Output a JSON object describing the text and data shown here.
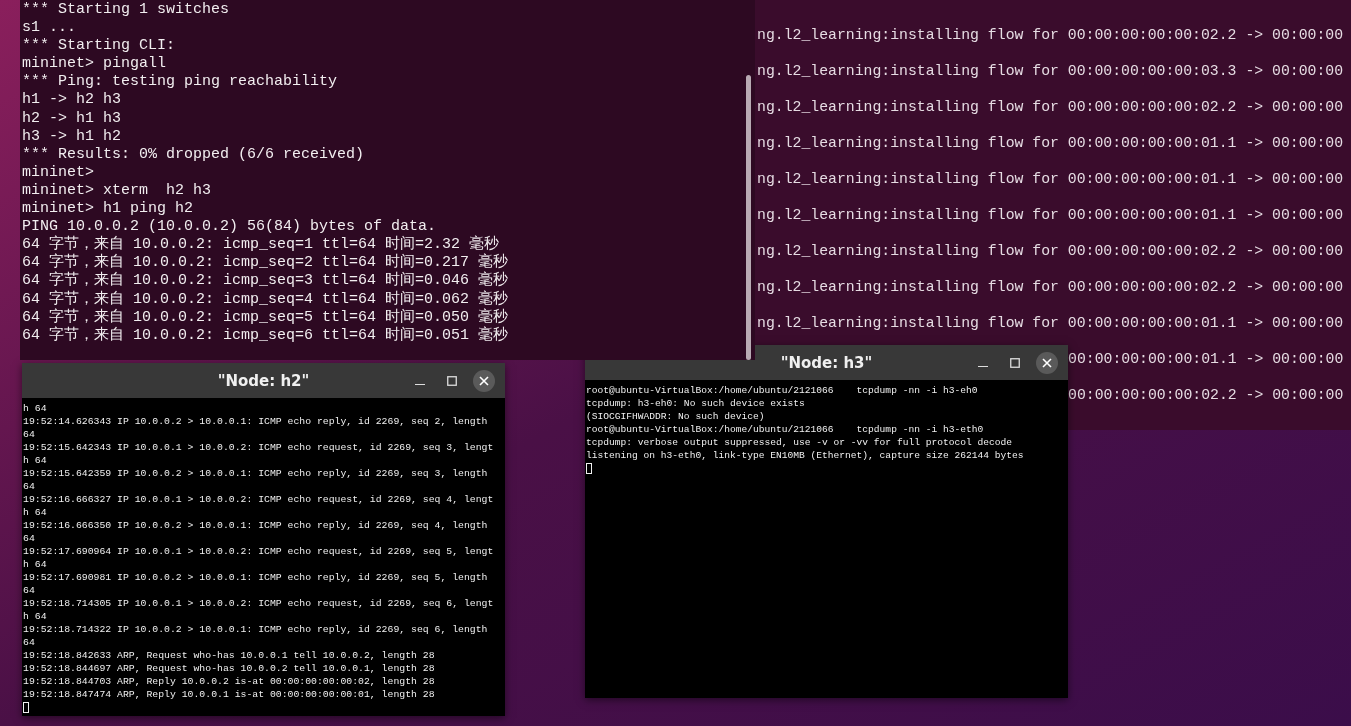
{
  "main_terminal": {
    "lines": [
      "*** Starting 1 switches",
      "s1 ...",
      "*** Starting CLI:",
      "mininet> pingall",
      "*** Ping: testing ping reachability",
      "h1 -> h2 h3",
      "h2 -> h1 h3",
      "h3 -> h1 h2",
      "*** Results: 0% dropped (6/6 received)",
      "mininet>",
      "mininet> xterm  h2 h3",
      "mininet> h1 ping h2",
      "PING 10.0.0.2 (10.0.0.2) 56(84) bytes of data.",
      "64 字节，来自 10.0.0.2: icmp_seq=1 ttl=64 时间=2.32 毫秒",
      "64 字节，来自 10.0.0.2: icmp_seq=2 ttl=64 时间=0.217 毫秒",
      "64 字节，来自 10.0.0.2: icmp_seq=3 ttl=64 时间=0.046 毫秒",
      "64 字节，来自 10.0.0.2: icmp_seq=4 ttl=64 时间=0.062 毫秒",
      "64 字节，来自 10.0.0.2: icmp_seq=5 ttl=64 时间=0.050 毫秒",
      "64 字节，来自 10.0.0.2: icmp_seq=6 ttl=64 时间=0.051 毫秒"
    ]
  },
  "background_terminal": {
    "lines": [
      {
        "kind": "full",
        "text": "ng.l2_learning:installing flow for 00:00:00:00:00:02.2 -> 00:00:00"
      },
      {
        "kind": "full",
        "text": "ng.l2_learning:installing flow for 00:00:00:00:00:03.3 -> 00:00:00"
      },
      {
        "kind": "full",
        "text": "ng.l2_learning:installing flow for 00:00:00:00:00:02.2 -> 00:00:00"
      },
      {
        "kind": "full",
        "text": "ng.l2_learning:installing flow for 00:00:00:00:00:01.1 -> 00:00:00"
      },
      {
        "kind": "full",
        "text": "ng.l2_learning:installing flow for 00:00:00:00:00:01.1 -> 00:00:00"
      },
      {
        "kind": "full",
        "text": "ng.l2_learning:installing flow for 00:00:00:00:00:01.1 -> 00:00:00"
      },
      {
        "kind": "full",
        "text": "ng.l2_learning:installing flow for 00:00:00:00:00:02.2 -> 00:00:00"
      },
      {
        "kind": "full",
        "text": "ng.l2_learning:installing flow for 00:00:00:00:00:02.2 -> 00:00:00"
      },
      {
        "kind": "full",
        "text": "ng.l2_learning:installing flow for 00:00:00:00:00:01.1 -> 00:00:00"
      },
      {
        "kind": "partial",
        "text": "00:00:00:00:00:01.1 -> 00:00:00"
      },
      {
        "kind": "partial",
        "text": "00:00:00:00:00:02.2 -> 00:00:00"
      }
    ]
  },
  "windows": [
    {
      "title": "\"Node: h2\"",
      "cursor": true,
      "lines": [
        "h 64",
        "19:52:14.626343 IP 10.0.0.2 > 10.0.0.1: ICMP echo reply, id 2269, seq 2, length",
        "64",
        "19:52:15.642343 IP 10.0.0.1 > 10.0.0.2: ICMP echo request, id 2269, seq 3, lengt",
        "h 64",
        "19:52:15.642359 IP 10.0.0.2 > 10.0.0.1: ICMP echo reply, id 2269, seq 3, length",
        "64",
        "19:52:16.666327 IP 10.0.0.1 > 10.0.0.2: ICMP echo request, id 2269, seq 4, lengt",
        "h 64",
        "19:52:16.666350 IP 10.0.0.2 > 10.0.0.1: ICMP echo reply, id 2269, seq 4, length",
        "64",
        "19:52:17.690964 IP 10.0.0.1 > 10.0.0.2: ICMP echo request, id 2269, seq 5, lengt",
        "h 64",
        "19:52:17.690981 IP 10.0.0.2 > 10.0.0.1: ICMP echo reply, id 2269, seq 5, length",
        "64",
        "19:52:18.714305 IP 10.0.0.1 > 10.0.0.2: ICMP echo request, id 2269, seq 6, lengt",
        "h 64",
        "19:52:18.714322 IP 10.0.0.2 > 10.0.0.1: ICMP echo reply, id 2269, seq 6, length",
        "64",
        "19:52:18.842633 ARP, Request who-has 10.0.0.1 tell 10.0.0.2, length 28",
        "19:52:18.844697 ARP, Request who-has 10.0.0.2 tell 10.0.0.1, length 28",
        "19:52:18.844703 ARP, Reply 10.0.0.2 is-at 00:00:00:00:00:02, length 28",
        "19:52:18.847474 ARP, Reply 10.0.0.1 is-at 00:00:00:00:00:01, length 28"
      ]
    },
    {
      "title": "\"Node: h3\"",
      "cursor": true,
      "lines": [
        "root@ubuntu-VirtualBox:/home/ubuntu/2121066    tcpdump -nn -i h3-eh0",
        "tcpdump: h3-eh0: No such device exists",
        "(SIOCGIFHWADDR: No such device)",
        "root@ubuntu-VirtualBox:/home/ubuntu/2121066    tcpdump -nn -i h3-eth0",
        "tcpdump: verbose output suppressed, use -v or -vv for full protocol decode",
        "listening on h3-eth0, link-type EN10MB (Ethernet), capture size 262144 bytes"
      ]
    }
  ]
}
